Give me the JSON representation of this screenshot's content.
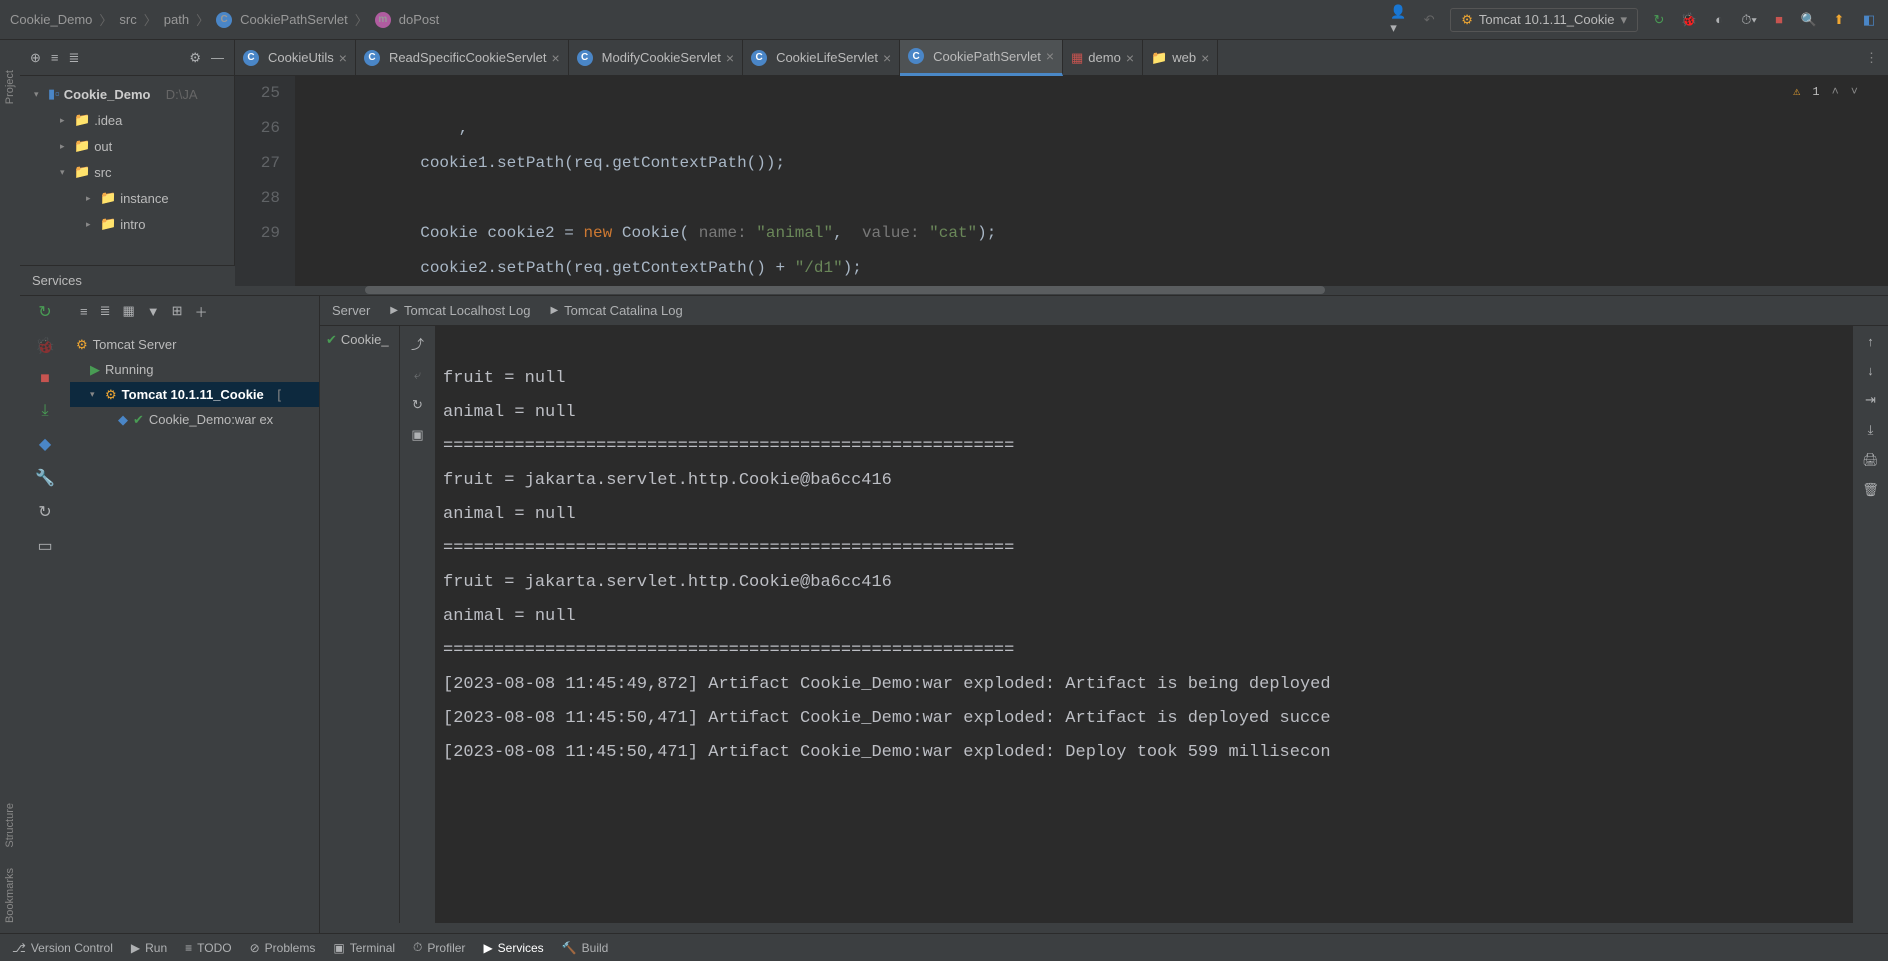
{
  "breadcrumbs": {
    "p1": "Cookie_Demo",
    "p2": "src",
    "p3": "path",
    "p4": "CookiePathServlet",
    "p5": "doPost"
  },
  "runConfig": "Tomcat 10.1.11_Cookie",
  "projectTree": {
    "root": "Cookie_Demo",
    "rootPath": "D:\\JA",
    "idea": ".idea",
    "out": "out",
    "src": "src",
    "instance": "instance",
    "intro": "intro"
  },
  "editorTabs": {
    "t1": "CookieUtils",
    "t2": "ReadSpecificCookieServlet",
    "t3": "ModifyCookieServlet",
    "t4": "CookieLifeServlet",
    "t5": "CookiePathServlet",
    "t6": "demo",
    "t7": "web"
  },
  "gutter": {
    "l25": "25",
    "l26": "26",
    "l27": "27",
    "l28": "28",
    "l29": "29"
  },
  "code": {
    "l26": "            cookie1.setPath(req.getContextPath());",
    "l28a": "            Cookie cookie2 = ",
    "l28b": "new",
    "l28c": " Cookie( ",
    "l28h1": "name:",
    "l28s1": " \"animal\"",
    "l28p1": ",  ",
    "l28h2": "value:",
    "l28s2": " \"cat\"",
    "l28e": ");",
    "l29a": "            cookie2.setPath(req.getContextPath() + ",
    "l29s": "\"/d1\"",
    "l29e": ");"
  },
  "warning": {
    "count": "1"
  },
  "services": {
    "title": "Services",
    "server": "Server",
    "log1": "Tomcat Localhost Log",
    "log2": "Tomcat Catalina Log",
    "tomcatServer": "Tomcat Server",
    "running": "Running",
    "configName": "Tomcat 10.1.11_Cookie",
    "configSuffix": "[",
    "artifact": "Cookie_Demo:war ex",
    "cookieLabel": "Cookie_"
  },
  "console": {
    "l1": "fruit = null",
    "l2": "animal = null",
    "l3": "========================================================",
    "l4": "fruit = jakarta.servlet.http.Cookie@ba6cc416",
    "l5": "animal = null",
    "l6": "========================================================",
    "l7": "fruit = jakarta.servlet.http.Cookie@ba6cc416",
    "l8": "animal = null",
    "l9": "========================================================",
    "l10": "[2023-08-08 11:45:49,872] Artifact Cookie_Demo:war exploded: Artifact is being deployed",
    "l11": "[2023-08-08 11:45:50,471] Artifact Cookie_Demo:war exploded: Artifact is deployed succe",
    "l12": "[2023-08-08 11:45:50,471] Artifact Cookie_Demo:war exploded: Deploy took 599 millisecon"
  },
  "bottomTabs": {
    "vc": "Version Control",
    "run": "Run",
    "todo": "TODO",
    "problems": "Problems",
    "terminal": "Terminal",
    "profiler": "Profiler",
    "services": "Services",
    "build": "Build"
  }
}
